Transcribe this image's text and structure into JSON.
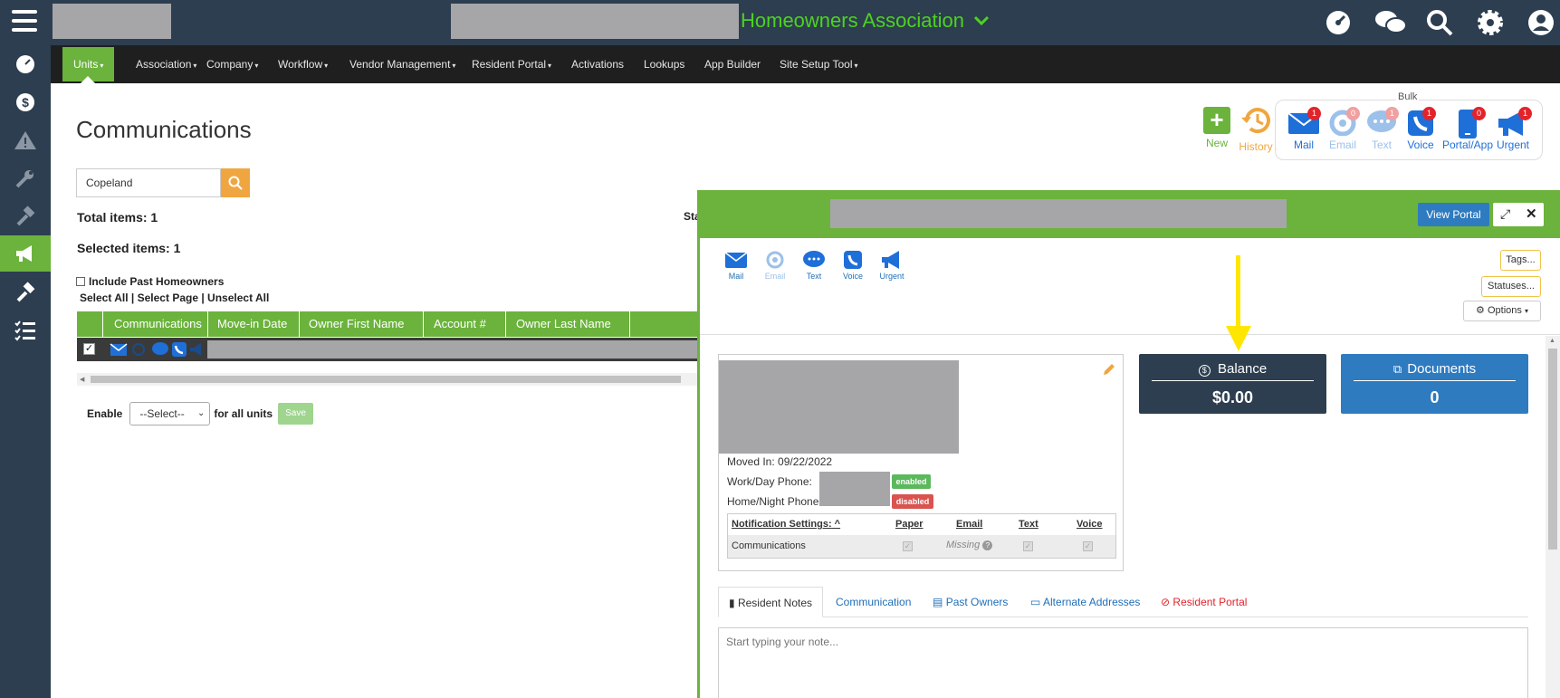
{
  "topbar": {
    "title": "Homeowners Association"
  },
  "nav": {
    "items": [
      "Units",
      "Association",
      "Company",
      "Workflow",
      "Vendor Management",
      "Resident Portal",
      "Activations",
      "Lookups",
      "App Builder",
      "Site Setup Tool"
    ]
  },
  "page": {
    "title": "Communications",
    "search_value": "Copeland",
    "total_items": "Total items: 1",
    "selected_items": "Selected items: 1",
    "status_partial": "Sta",
    "include_past": "Include Past Homeowners",
    "select_all": "Select All",
    "select_page": "Select Page",
    "unselect_all": "Unselect All",
    "sep": "|",
    "columns": [
      "Communications",
      "Move-in Date",
      "Owner First Name",
      "Account #",
      "Owner Last Name"
    ],
    "enable_label": "Enable",
    "select_value": "--Select--",
    "for_all_units": "for all units",
    "save_label": "Save"
  },
  "actions": {
    "new_label": "New",
    "history_label": "History",
    "bulk_label": "Bulk",
    "bulk": [
      {
        "label": "Mail",
        "count": "1",
        "icon": "mail-icon",
        "color": "#1f6fd8"
      },
      {
        "label": "Email",
        "count": "0",
        "icon": "at-icon",
        "color": "#9cc1ea"
      },
      {
        "label": "Text",
        "count": "1",
        "icon": "chat-icon",
        "color": "#9cc1ea"
      },
      {
        "label": "Voice",
        "count": "1",
        "icon": "phone-icon",
        "color": "#1f6fd8"
      },
      {
        "label": "Portal/App",
        "count": "0",
        "icon": "mobile-icon",
        "color": "#1f6fd8"
      },
      {
        "label": "Urgent",
        "count": "1",
        "icon": "megaphone-icon",
        "color": "#1f6fd8"
      }
    ]
  },
  "panel": {
    "view_portal": "View Portal",
    "mini_icons": [
      "Mail",
      "Email",
      "Text",
      "Voice",
      "Urgent"
    ],
    "tags": "Tags...",
    "statuses": "Statuses...",
    "options": "Options",
    "balance_label": "Balance",
    "balance_value": "$0.00",
    "documents_label": "Documents",
    "documents_value": "0",
    "moved_in": "Moved In: 09/22/2022",
    "work_phone": "Work/Day Phone:",
    "home_phone": "Home/Night Phone:",
    "enabled": "enabled",
    "disabled": "disabled",
    "notif_settings": "Notification Settings:",
    "notif_cols": [
      "Paper",
      "Email",
      "Text",
      "Voice"
    ],
    "notif_row": "Communications",
    "missing": "Missing",
    "tabs": [
      "Resident Notes",
      "Communication",
      "Past Owners",
      "Alternate Addresses",
      "Resident Portal"
    ],
    "note_placeholder": "Start typing your note..."
  },
  "colors": {
    "green": "#6bb33c",
    "navy": "#2d3e50",
    "blue": "#2f7bc0",
    "balance": "#2d3e50",
    "arrow": "#ffe600"
  }
}
